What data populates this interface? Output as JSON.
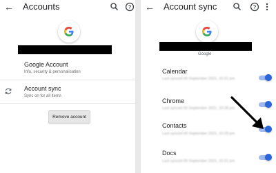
{
  "left_screen": {
    "title": "Accounts",
    "back_icon": "arrow-left",
    "toolbar_icons": [
      "search",
      "help"
    ],
    "account_email": "",
    "items": [
      {
        "title": "Google Account",
        "subtitle": "Info, security & personalisation"
      },
      {
        "title": "Account sync",
        "subtitle": "Sync on for all items",
        "icon": "sync"
      }
    ],
    "remove_button": "Remove account"
  },
  "right_screen": {
    "title": "Account sync",
    "back_icon": "arrow-left",
    "toolbar_icons": [
      "search",
      "help",
      "more-vert"
    ],
    "account_email": "",
    "account_type": "Google",
    "sync_items": [
      {
        "title": "Calendar",
        "detail": "Last synced 09 September 2021, 10:31 pm",
        "enabled": true
      },
      {
        "title": "Chrome",
        "detail": "Last synced 09 September 2021, 10:28 pm",
        "enabled": true
      },
      {
        "title": "Contacts",
        "detail": "Last synced 09 September 2021, 10:29 pm",
        "enabled": true
      },
      {
        "title": "Docs",
        "detail": "Last synced 09 September 2021, 10:31 pm",
        "enabled": true
      }
    ],
    "annotation_icon": "arrow-pointer"
  },
  "colors": {
    "toggle_thumb": "#2a65d9",
    "toggle_track": "#9fb9ee",
    "redaction": "#000000",
    "divider_gap": "#e8e8e8"
  }
}
